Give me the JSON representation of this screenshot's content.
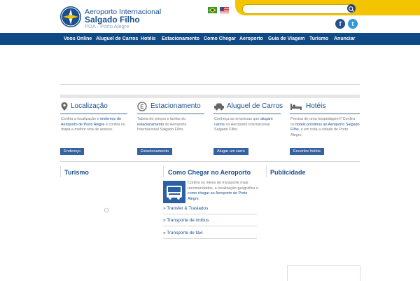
{
  "header": {
    "title_line1": "Aeroporto Internacional",
    "title_line2": "Salgado Filho",
    "subtitle": "POA - Porto Alegre",
    "search": {
      "placeholder": ""
    },
    "social": {
      "facebook": "f",
      "twitter": "t"
    }
  },
  "nav": {
    "items": [
      {
        "label": "Voos Online"
      },
      {
        "label": "Aluguel de Carros"
      },
      {
        "label": "Hotéis"
      },
      {
        "label": "Estacionamento"
      },
      {
        "label": "Como Chegar"
      },
      {
        "label": "Aeroporto"
      },
      {
        "label": "Guia de Viagem"
      },
      {
        "label": "Turismo"
      },
      {
        "label": "Anunciar"
      }
    ]
  },
  "sections": [
    {
      "title": "Localização",
      "icon": "map-pin-icon",
      "text_a": "Confira a localização e ",
      "link_a": "endereço do Aeroporto de Porto Alegre",
      "text_b": " e confira no mapa a melhor rota de acesso.",
      "button": "Endereço"
    },
    {
      "title": "Estacionamento",
      "icon": "parking-icon",
      "text_a": "Tabela de preços e tarifas do ",
      "link_a": "estacionamento",
      "text_b": " do Aeroporto Internacional Salgado Filho.",
      "button": "Estacionamento"
    },
    {
      "title": "Aluguel de Carros",
      "icon": "car-icon",
      "text_a": "Conheça as empresas que ",
      "link_a": "alugam carros",
      "text_b": " no Aeroporto Internacional Salgado Filho.",
      "button": "Alugar um carro"
    },
    {
      "title": "Hotéis",
      "icon": "bed-icon",
      "text_a": "Precisa de uma hospedagem? Confira os ",
      "link_a": "hotéis próximos ao Aeroporto Salgado Filho",
      "text_b": ", e em toda a cidade de Porto Alegre.",
      "button": "Encontre hotéis"
    }
  ],
  "bottom": {
    "turismo_title": "Turismo",
    "como_chegar": {
      "title": "Como Chegar no Aeroporto",
      "text_a": "Confira os meios de transporte mais recomendados, a localização geográfica e ",
      "link_a": "como chegar ao Aeroporto de Porto Alegre",
      "text_b": ".",
      "links": [
        "» Transfer & Traslados",
        "» Transporte de ônibus",
        "» Transporte de táxi"
      ]
    },
    "publicidade_title": "Publicidade"
  },
  "colors": {
    "brand_blue": "#1a4f8f",
    "nav_blue": "#0f4a86",
    "accent_yellow": "#f5c400",
    "button_blue": "#3662a3"
  }
}
